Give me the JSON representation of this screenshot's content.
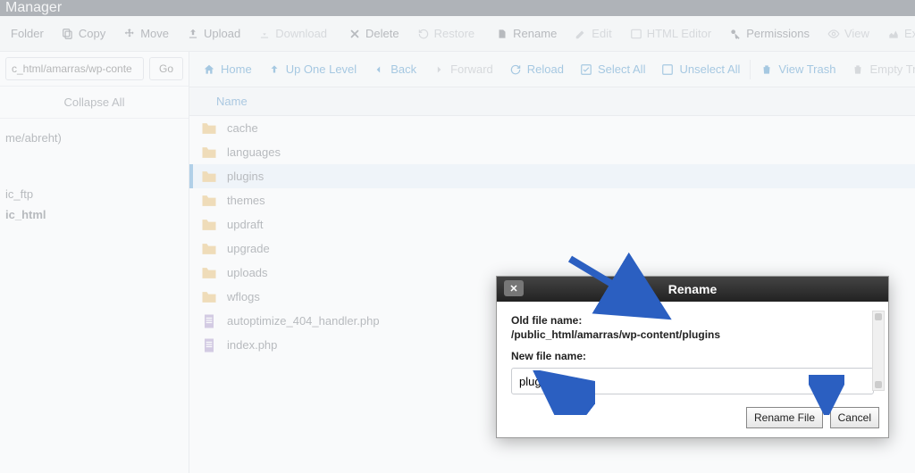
{
  "app_title": "Manager",
  "toolbar": {
    "folder": "Folder",
    "copy": "Copy",
    "move": "Move",
    "upload": "Upload",
    "download": "Download",
    "delete": "Delete",
    "restore": "Restore",
    "rename": "Rename",
    "edit": "Edit",
    "html_editor": "HTML Editor",
    "permissions": "Permissions",
    "view": "View",
    "extract": "Extr"
  },
  "sidebar": {
    "path_value": "c_html/amarras/wp-conte",
    "go": "Go",
    "collapse": "Collapse All",
    "tree": {
      "home": "me/abreht)",
      "ftp": "ic_ftp",
      "html": "ic_html"
    }
  },
  "navbar": {
    "home": "Home",
    "up": "Up One Level",
    "back": "Back",
    "forward": "Forward",
    "reload": "Reload",
    "select_all": "Select All",
    "unselect_all": "Unselect All",
    "view_trash": "View Trash",
    "empty_trash": "Empty Trash"
  },
  "columns": {
    "name": "Name"
  },
  "files": [
    {
      "name": "cache",
      "type": "folder"
    },
    {
      "name": "languages",
      "type": "folder"
    },
    {
      "name": "plugins",
      "type": "folder",
      "selected": true
    },
    {
      "name": "themes",
      "type": "folder"
    },
    {
      "name": "updraft",
      "type": "folder"
    },
    {
      "name": "upgrade",
      "type": "folder"
    },
    {
      "name": "uploads",
      "type": "folder"
    },
    {
      "name": "wflogs",
      "type": "folder"
    },
    {
      "name": "autoptimize_404_handler.php",
      "type": "php"
    },
    {
      "name": "index.php",
      "type": "php"
    }
  ],
  "modal": {
    "title": "Rename",
    "old_label": "Old file name:",
    "old_value": "/public_html/amarras/wp-content/plugins",
    "new_label": "New file name:",
    "new_value": "plugins_BK",
    "btn_rename": "Rename File",
    "btn_cancel": "Cancel"
  }
}
